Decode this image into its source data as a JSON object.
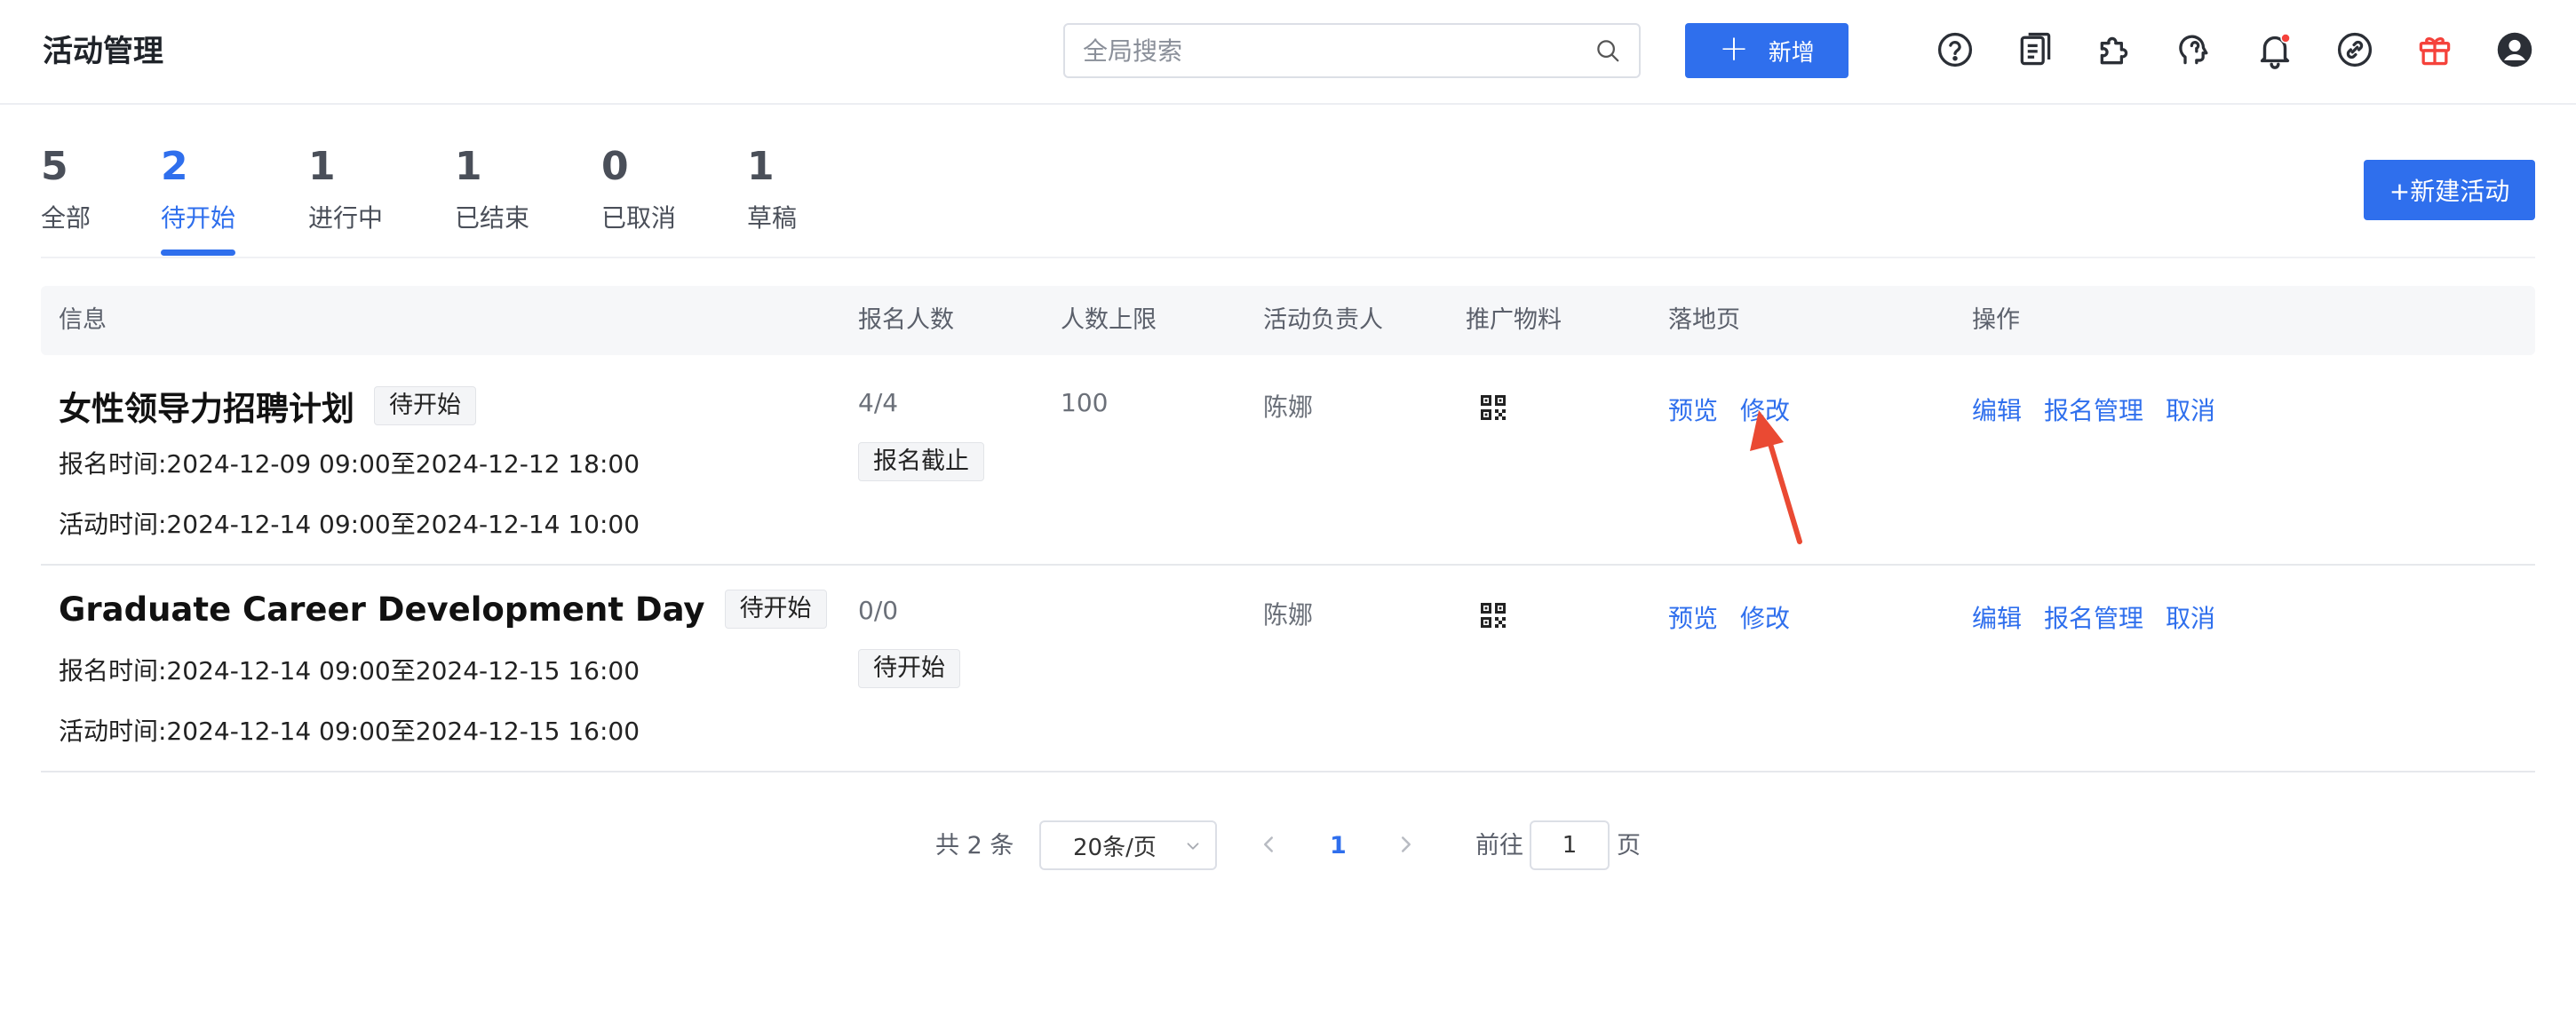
{
  "header": {
    "title": "活动管理",
    "search_placeholder": "全局搜索",
    "add_label": "新增",
    "notification_dot_color": "#f5423b",
    "gift_icon_color": "#f5423b",
    "icons": [
      "help-icon",
      "document-icon",
      "plugin-icon",
      "brain-icon",
      "bell-icon",
      "link-icon",
      "gift-icon",
      "user-avatar-icon"
    ]
  },
  "tabs": [
    {
      "count": "5",
      "label": "全部",
      "active": false
    },
    {
      "count": "2",
      "label": "待开始",
      "active": true
    },
    {
      "count": "1",
      "label": "进行中",
      "active": false
    },
    {
      "count": "1",
      "label": "已结束",
      "active": false
    },
    {
      "count": "0",
      "label": "已取消",
      "active": false
    },
    {
      "count": "1",
      "label": "草稿",
      "active": false
    }
  ],
  "new_activity_label": "+新建活动",
  "table": {
    "columns": [
      "信息",
      "报名人数",
      "人数上限",
      "活动负责人",
      "推广物料",
      "落地页",
      "操作"
    ],
    "rows": [
      {
        "title": "女性领导力招聘计划",
        "status": "待开始",
        "signup_time": "报名时间:2024-12-09 09:00至2024-12-12 18:00",
        "activity_time": "活动时间:2024-12-14 09:00至2024-12-14 10:00",
        "signups": "4/4",
        "signup_status": "报名截止",
        "limit": "100",
        "owner": "陈娜",
        "landing": [
          "预览",
          "修改"
        ],
        "actions": [
          "编辑",
          "报名管理",
          "取消"
        ]
      },
      {
        "title": "Graduate Career Development Day",
        "status": "待开始",
        "signup_time": "报名时间:2024-12-14 09:00至2024-12-15 16:00",
        "activity_time": "活动时间:2024-12-14 09:00至2024-12-15 16:00",
        "signups": "0/0",
        "signup_status": "待开始",
        "limit": "",
        "owner": "陈娜",
        "landing": [
          "预览",
          "修改"
        ],
        "actions": [
          "编辑",
          "报名管理",
          "取消"
        ]
      }
    ]
  },
  "pagination": {
    "total": "共 2 条",
    "page_size": "20条/页",
    "current_page": "1",
    "goto_label": "前往",
    "goto_value": "1",
    "page_suffix": "页"
  },
  "colors": {
    "accent": "#2f6fed",
    "annotation_arrow": "#ea4a33"
  }
}
